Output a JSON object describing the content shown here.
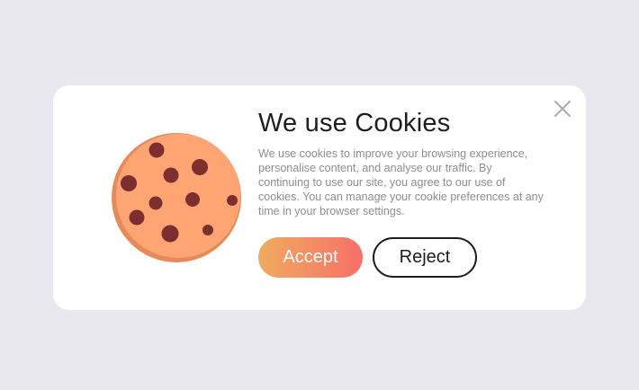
{
  "dialog": {
    "title": "We use Cookies",
    "description": "We use cookies to improve your browsing experience, personalise content, and analyse our traffic. By continuing to use our site, you agree to our use of cookies. You can manage your cookie preferences at any time in your browser settings.",
    "accept_label": "Accept",
    "reject_label": "Reject",
    "close_icon": "close-icon",
    "illustration_icon": "cookie-icon"
  },
  "colors": {
    "background": "#e8e8ee",
    "card": "#ffffff",
    "title": "#1e1e1e",
    "description": "#8e8e8e",
    "accept_gradient_start": "#f0ac5f",
    "accept_gradient_end": "#f76f68",
    "reject_border": "#1e1e1e",
    "cookie_body": "#ffa574",
    "cookie_edge": "#e68a5c",
    "cookie_chips": "#7d2f2f"
  }
}
